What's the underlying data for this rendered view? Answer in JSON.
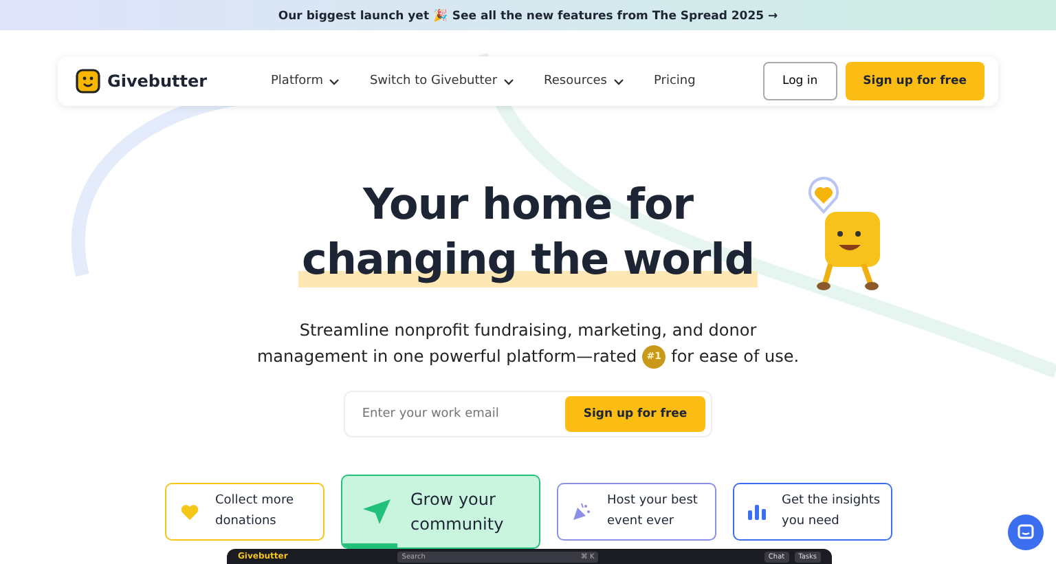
{
  "banner": {
    "text": "Our biggest launch yet 🎉 See all the new features from The Spread 2025 →"
  },
  "nav": {
    "brand": "Givebutter",
    "links": [
      {
        "label": "Platform",
        "dropdown": true
      },
      {
        "label": "Switch to Givebutter",
        "dropdown": true
      },
      {
        "label": "Resources",
        "dropdown": true
      },
      {
        "label": "Pricing",
        "dropdown": false
      }
    ],
    "login": "Log in",
    "signup": "Sign up for free"
  },
  "hero": {
    "title_line_1": "Your home for",
    "title_line_2": "changing the world",
    "subtitle_1": "Streamline nonprofit fundraising, marketing, and donor",
    "subtitle_2": "management in one powerful platform—rated",
    "badge": "#1",
    "subtitle_3": "for ease of use."
  },
  "signup_form": {
    "placeholder": "Enter your work email",
    "button": "Sign up for free"
  },
  "cards": [
    {
      "kind": "heart",
      "label_1": "Collect more",
      "label_2": "donations",
      "color": "#f5c518",
      "selected": false
    },
    {
      "kind": "plane",
      "label_1": "Grow your",
      "label_2": "community",
      "color": "#22c07a",
      "selected": true,
      "level": 0.28
    },
    {
      "kind": "confetti",
      "label_1": "Host your best",
      "label_2": "event ever",
      "color": "#8b8fe6",
      "selected": false
    },
    {
      "kind": "chart",
      "label_1": "Get the insights",
      "label_2": "you need",
      "color": "#3b6ff0",
      "selected": false
    }
  ],
  "app_preview": {
    "brand": "Givebutter",
    "search": "Search",
    "shortcut": "⌘ K",
    "chat": "Chat",
    "tasks": "Tasks"
  }
}
